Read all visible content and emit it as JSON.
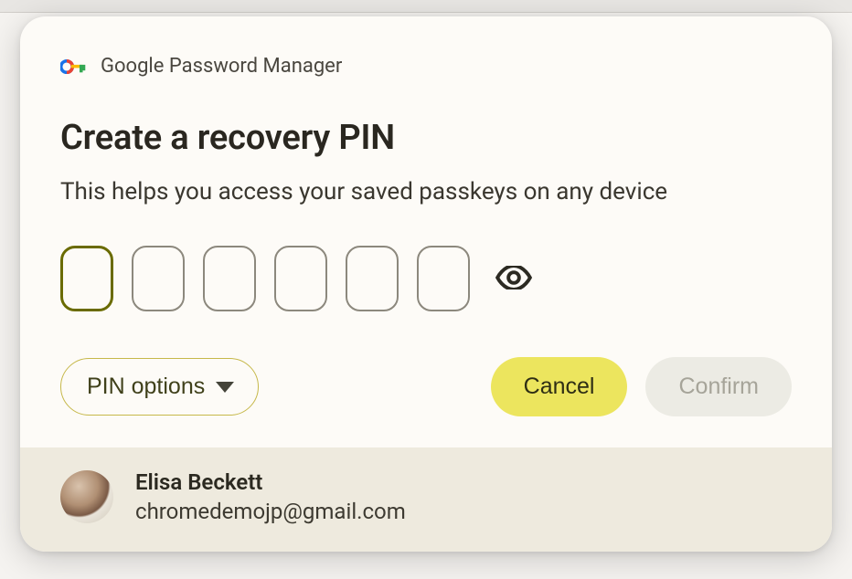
{
  "brand": {
    "label": "Google Password Manager"
  },
  "dialog": {
    "title": "Create a recovery PIN",
    "subtitle": "This helps you access your saved passkeys on any device"
  },
  "pin": {
    "length": 6,
    "activeIndex": 0
  },
  "actions": {
    "pinOptionsLabel": "PIN options",
    "cancelLabel": "Cancel",
    "confirmLabel": "Confirm"
  },
  "account": {
    "name": "Elisa Beckett",
    "email": "chromedemojp@gmail.com"
  }
}
